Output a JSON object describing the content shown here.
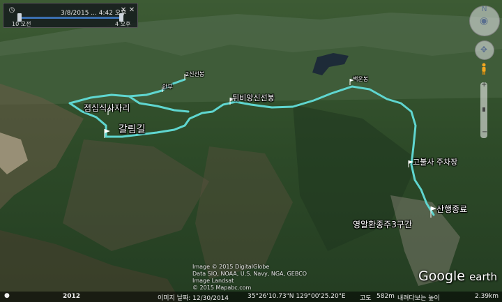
{
  "time_slider": {
    "current": "3/8/2015 ... 4:42 오후",
    "start": "10 오전",
    "end": "4 오후"
  },
  "map_labels": {
    "trail_points": [
      {
        "id": "rest-area",
        "text": "점심식사자리"
      },
      {
        "id": "branch-path",
        "text": "갈림길"
      },
      {
        "id": "peak-a",
        "text": "2신선봉"
      },
      {
        "id": "saddle",
        "text": "안부"
      },
      {
        "id": "shinseonbong",
        "text": "뒤비앙신선봉"
      },
      {
        "id": "summit-east",
        "text": "백운봉"
      },
      {
        "id": "temple-parking",
        "text": "고불사 주차장"
      },
      {
        "id": "finish",
        "text": "산행종료"
      },
      {
        "id": "route-name",
        "text": "영알환종주3구간"
      }
    ]
  },
  "credits": [
    "Image © 2015 DigitalGlobe",
    "Data SIO, NOAA, U.S. Navy, NGA, GEBCO",
    "Image Landsat",
    "© 2015 Mapabc.com"
  ],
  "logo": {
    "brand": "Google",
    "product": "earth"
  },
  "status_bar": {
    "imagery_date": "이미지 날짜: 12/30/2014",
    "coordinates": "35°26'10.73\"N 129°00'25.20\"E",
    "elevation_label": "고도",
    "elevation": "582m",
    "eye_label": "내려다보는 높이",
    "eye_altitude": "2.39km",
    "year_badge": "2012"
  },
  "colors": {
    "track": "#5fd6d0",
    "water": "#1d2b38"
  },
  "icons": {
    "flag": "flag-icon",
    "compass": "compass-icon",
    "look": "look-joystick-icon",
    "move": "move-joystick-icon",
    "pegman": "pegman-icon",
    "zoom": "zoom-slider-icon"
  }
}
